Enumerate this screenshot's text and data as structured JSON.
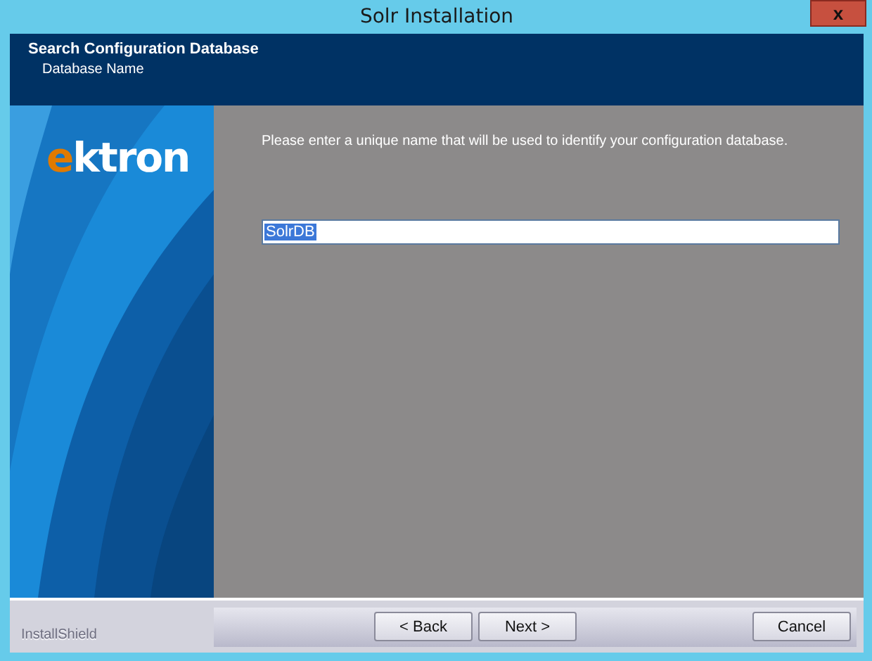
{
  "window": {
    "title": "Solr Installation",
    "close": "x"
  },
  "header": {
    "title": "Search Configuration Database",
    "subtitle": "Database Name"
  },
  "logo": "ektron",
  "prompt": "Please enter a unique name that will be used to identify your configuration database.",
  "name_field": {
    "value": "SolrDB",
    "text_selected": true
  },
  "footer": {
    "brand": "InstallShield"
  },
  "buttons": [
    {
      "label": "< Back",
      "kind": "nav"
    },
    {
      "label": "Next >",
      "kind": "nav"
    },
    {
      "label": "Cancel",
      "kind": "cancel"
    }
  ]
}
